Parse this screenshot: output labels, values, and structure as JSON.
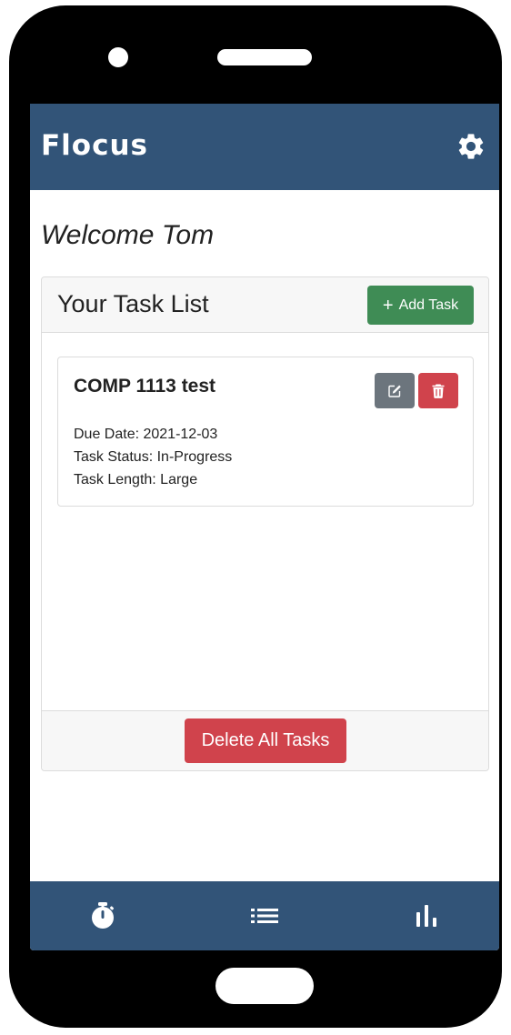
{
  "app": {
    "brand": "Flocus"
  },
  "icons": {
    "settings": "gear-icon",
    "edit": "pencil-square-icon",
    "delete": "trash-icon",
    "timer": "stopwatch-icon",
    "list": "list-icon",
    "stats": "bar-chart-icon"
  },
  "colors": {
    "navbar": "#325478",
    "success": "#3f8c55",
    "danger": "#d0434c",
    "secondary": "#6c757d"
  },
  "welcome": "Welcome Tom",
  "task_list": {
    "title": "Your Task List",
    "add_label": "Add Task",
    "add_icon": "+",
    "tasks": [
      {
        "name": "COMP 1113 test",
        "due": "Due Date: 2021-12-03",
        "status": "Task Status: In-Progress",
        "length": "Task Length: Large"
      }
    ],
    "delete_all_label": "Delete All Tasks"
  }
}
